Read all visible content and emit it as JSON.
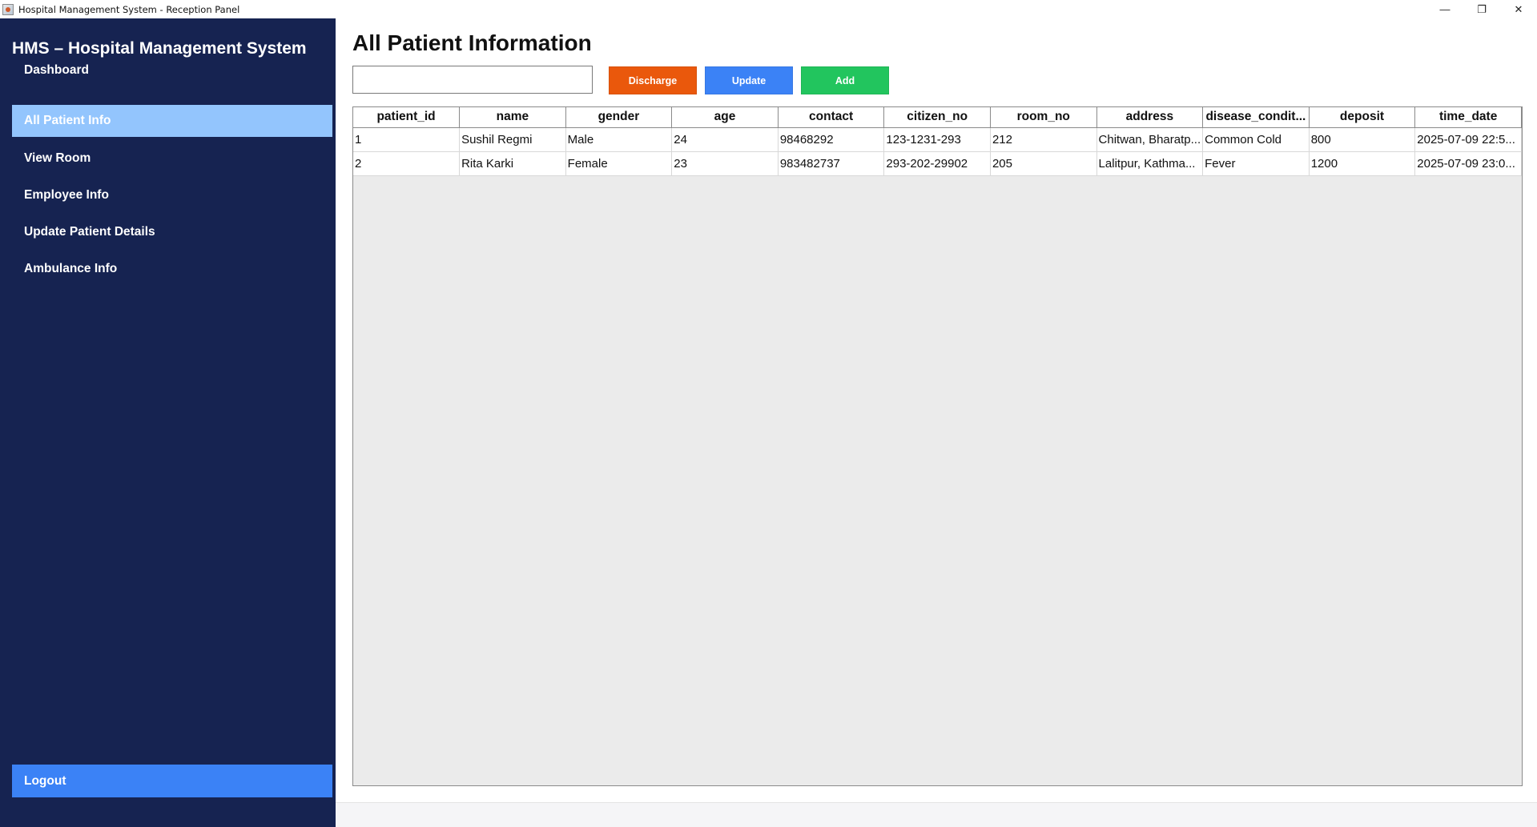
{
  "window": {
    "title": "Hospital Management System - Reception Panel",
    "controls": {
      "minimize": "—",
      "maximize": "❐",
      "close": "✕"
    }
  },
  "sidebar": {
    "brand": "HMS – Hospital Management System",
    "items": [
      {
        "label": "Dashboard",
        "active": false
      },
      {
        "label": "All Patient Info",
        "active": true
      },
      {
        "label": "View Room",
        "active": false
      },
      {
        "label": "Employee Info",
        "active": false
      },
      {
        "label": "Update Patient Details",
        "active": false
      },
      {
        "label": "Ambulance Info",
        "active": false
      }
    ],
    "logout_label": "Logout"
  },
  "main": {
    "title": "All Patient Information",
    "search": {
      "value": "",
      "placeholder": ""
    },
    "buttons": {
      "discharge": "Discharge",
      "update": "Update",
      "add": "Add"
    },
    "table": {
      "columns": [
        "patient_id",
        "name",
        "gender",
        "age",
        "contact",
        "citizen_no",
        "room_no",
        "address",
        "disease_condit...",
        "deposit",
        "time_date"
      ],
      "rows": [
        [
          "1",
          "Sushil Regmi",
          "Male",
          "24",
          "98468292",
          "123-1231-293",
          "212",
          "Chitwan, Bharatp...",
          "Common Cold",
          "800",
          "2025-07-09 22:5..."
        ],
        [
          "2",
          "Rita Karki",
          "Female",
          "23",
          "983482737",
          "293-202-29902",
          "205",
          "Lalitpur, Kathma...",
          "Fever",
          "1200",
          "2025-07-09 23:0..."
        ]
      ]
    }
  },
  "colors": {
    "sidebar_bg": "#162351",
    "active_nav": "#93c5fd",
    "logout_bg": "#3b82f6",
    "discharge": "#ea580c",
    "update": "#3b82f6",
    "add": "#22c55e"
  }
}
